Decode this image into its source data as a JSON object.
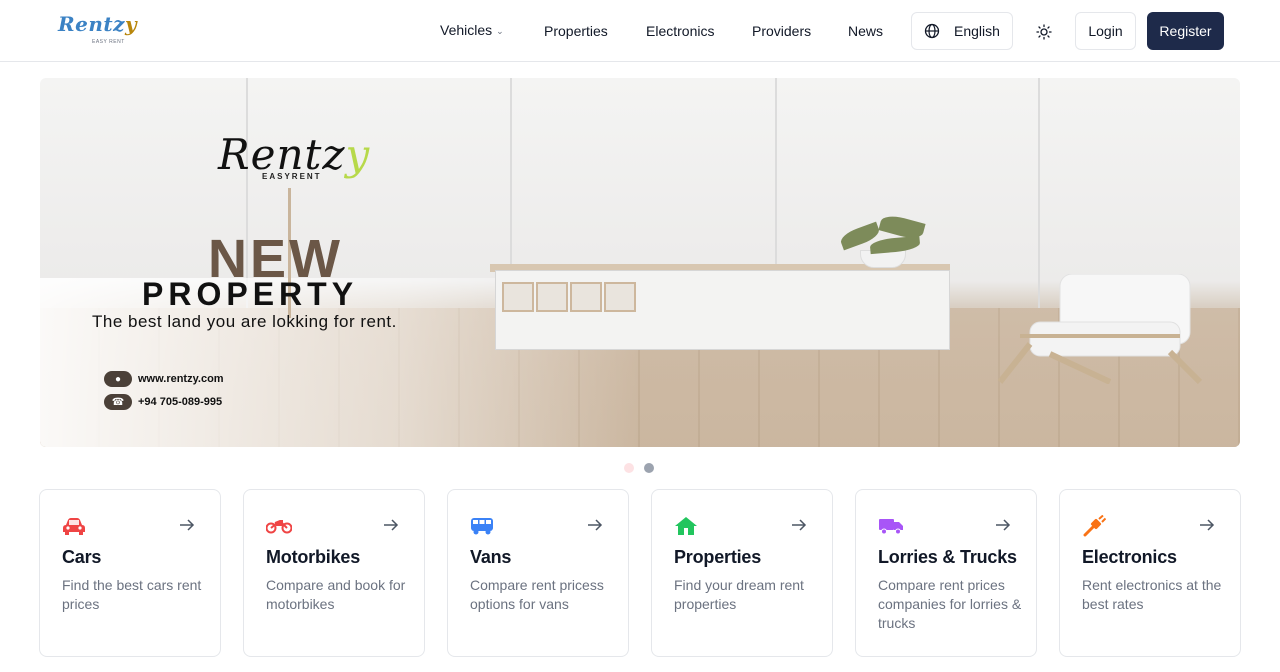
{
  "header": {
    "logo_text_main": "Rentz",
    "logo_text_y": "y",
    "logo_sub": "EASY RENT",
    "nav": {
      "vehicles": "Vehicles",
      "properties": "Properties",
      "electronics": "Electronics",
      "providers": "Providers",
      "news": "News"
    },
    "language": "English",
    "login": "Login",
    "register": "Register"
  },
  "banner": {
    "logo_text_main": "Rentz",
    "logo_text_y": "y",
    "logo_sub": "EASYRENT",
    "headline_1": "NEW",
    "headline_2": "PROPERTY",
    "tagline": "The best land you are lokking for rent.",
    "website": "www.rentzy.com",
    "phone": "+94 705-089-995"
  },
  "carousel": {
    "slides": 2,
    "active_slide": 2
  },
  "categories": [
    {
      "title": "Cars",
      "description": "Find the best cars rent prices",
      "icon": "car-icon",
      "color": "#ef4444"
    },
    {
      "title": "Motorbikes",
      "description": "Compare and book for motorbikes",
      "icon": "motorbike-icon",
      "color": "#ef4444"
    },
    {
      "title": "Vans",
      "description": "Compare rent pricess options for vans",
      "icon": "van-icon",
      "color": "#3b82f6"
    },
    {
      "title": "Properties",
      "description": "Find your dream rent properties",
      "icon": "home-icon",
      "color": "#22c55e"
    },
    {
      "title": "Lorries & Trucks",
      "description": "Compare rent prices companies for lorries & trucks",
      "icon": "truck-icon",
      "color": "#a855f7"
    },
    {
      "title": "Electronics",
      "description": "Rent electronics at the best rates",
      "icon": "plug-icon",
      "color": "#f97316"
    }
  ],
  "colors": {
    "register_bg": "#1e2a4a",
    "text_primary": "#111827",
    "text_muted": "#6b7280",
    "border": "#e5e7eb"
  }
}
